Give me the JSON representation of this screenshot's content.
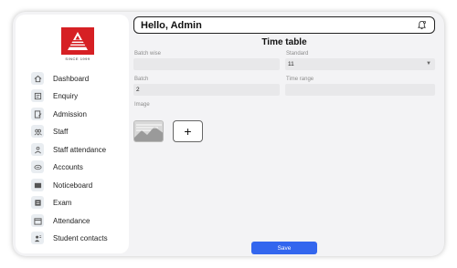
{
  "sidebar": {
    "logo": {
      "caption": "SINCE 1999",
      "color": "#d62024"
    },
    "items": [
      {
        "label": "Dashboard",
        "icon": "home-icon"
      },
      {
        "label": "Enquiry",
        "icon": "enquiry-icon"
      },
      {
        "label": "Admission",
        "icon": "admission-icon"
      },
      {
        "label": "Staff",
        "icon": "staff-icon"
      },
      {
        "label": "Staff attendance",
        "icon": "staff-attendance-icon"
      },
      {
        "label": "Accounts",
        "icon": "accounts-icon"
      },
      {
        "label": "Noticeboard",
        "icon": "noticeboard-icon"
      },
      {
        "label": "Exam",
        "icon": "exam-icon"
      },
      {
        "label": "Attendance",
        "icon": "attendance-icon"
      },
      {
        "label": "Student contacts",
        "icon": "contacts-icon"
      }
    ]
  },
  "header": {
    "greeting": "Hello, Admin",
    "icon": "notification-bell-icon"
  },
  "form": {
    "title": "Time table",
    "batch_wise": {
      "label": "Batch wise",
      "value": ""
    },
    "standard": {
      "label": "Standard",
      "value": "11"
    },
    "batch": {
      "label": "Batch",
      "value": "2"
    },
    "time_range": {
      "label": "Time range",
      "value": ""
    },
    "image": {
      "label": "Image"
    },
    "add_label": "+",
    "save_label": "Save"
  },
  "colors": {
    "accent": "#3366ee",
    "brand": "#d62024"
  }
}
